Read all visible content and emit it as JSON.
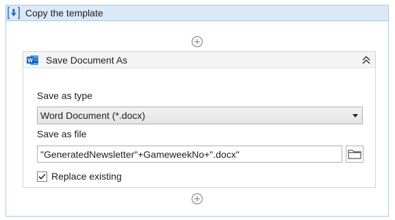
{
  "sequence": {
    "title": "Copy the template",
    "icon": "sequence-download-icon"
  },
  "activity": {
    "title": "Save Document As",
    "icon": "word-icon",
    "save_as_type": {
      "label": "Save as type",
      "value": "Word Document (*.docx)"
    },
    "save_as_file": {
      "label": "Save as file",
      "value": "\"GeneratedNewsletter\"+GameweekNo+\".docx\""
    },
    "replace_existing": {
      "label": "Replace existing",
      "checked": true
    }
  },
  "colors": {
    "header_bg": "#dbe8f6",
    "border": "#a9c6e3",
    "word_blue": "#185abd"
  }
}
